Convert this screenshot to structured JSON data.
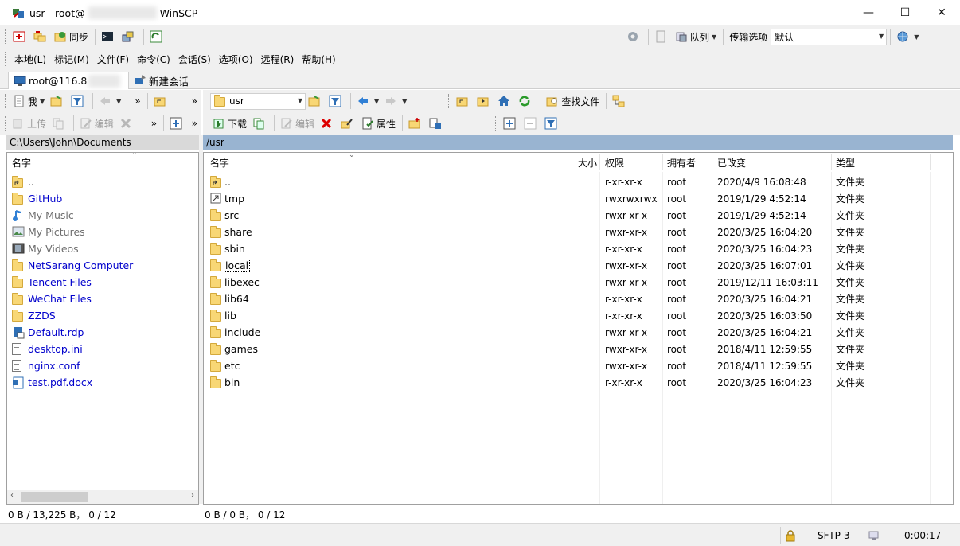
{
  "window": {
    "title_prefix": "usr - root@",
    "title_suffix": "WinSCP",
    "minimize": "—",
    "maximize": "☐",
    "close": "✕"
  },
  "toolbar1": {
    "sync_label": "同步",
    "queue_label": "队列",
    "transfer_options_label": "传输选项",
    "transfer_preset": "默认"
  },
  "menu": [
    "本地(L)",
    "标记(M)",
    "文件(F)",
    "命令(C)",
    "会话(S)",
    "选项(O)",
    "远程(R)",
    "帮助(H)"
  ],
  "tabs": {
    "session_label": "root@116.8",
    "new_session_label": "新建会话"
  },
  "left_toolbar": {
    "drive_label": "我",
    "upload_label": "上传",
    "edit_label": "编辑"
  },
  "right_toolbar": {
    "path_combo": "usr",
    "find_files_label": "查找文件",
    "download_label": "下载",
    "edit_label": "编辑",
    "properties_label": "属性"
  },
  "left_panel": {
    "path": "C:\\Users\\John\\Documents",
    "col_name": "名字",
    "items": [
      {
        "name": "..",
        "icon": "parent-folder-icon",
        "color": "#000000"
      },
      {
        "name": "GitHub",
        "icon": "folder-icon",
        "color": "#0000cc"
      },
      {
        "name": "My Music",
        "icon": "music-icon",
        "color": "#6d6d6d"
      },
      {
        "name": "My Pictures",
        "icon": "pictures-icon",
        "color": "#6d6d6d"
      },
      {
        "name": "My Videos",
        "icon": "videos-icon",
        "color": "#6d6d6d"
      },
      {
        "name": "NetSarang Computer",
        "icon": "folder-icon",
        "color": "#0000cc"
      },
      {
        "name": "Tencent Files",
        "icon": "folder-icon",
        "color": "#0000cc"
      },
      {
        "name": "WeChat Files",
        "icon": "folder-icon",
        "color": "#0000cc"
      },
      {
        "name": "ZZDS",
        "icon": "folder-icon",
        "color": "#0000cc"
      },
      {
        "name": "Default.rdp",
        "icon": "rdp-file-icon",
        "color": "#0000cc"
      },
      {
        "name": "desktop.ini",
        "icon": "ini-file-icon",
        "color": "#0000cc"
      },
      {
        "name": "nginx.conf",
        "icon": "conf-file-icon",
        "color": "#0000cc"
      },
      {
        "name": "test.pdf.docx",
        "icon": "docx-file-icon",
        "color": "#0000cc"
      }
    ],
    "status": "0 B / 13,225 B， 0 / 12"
  },
  "right_panel": {
    "path": "/usr",
    "columns": {
      "name": "名字",
      "size": "大小",
      "perm": "权限",
      "owner": "拥有者",
      "changed": "已改变",
      "type": "类型"
    },
    "items": [
      {
        "name": "..",
        "perm": "r-xr-xr-x",
        "owner": "root",
        "changed": "2020/4/9 16:08:48",
        "type": "文件夹",
        "icon": "parent-folder-icon"
      },
      {
        "name": "tmp",
        "perm": "rwxrwxrwx",
        "owner": "root",
        "changed": "2019/1/29 4:52:14",
        "type": "文件夹",
        "icon": "link-icon"
      },
      {
        "name": "src",
        "perm": "rwxr-xr-x",
        "owner": "root",
        "changed": "2019/1/29 4:52:14",
        "type": "文件夹",
        "icon": "folder-icon"
      },
      {
        "name": "share",
        "perm": "rwxr-xr-x",
        "owner": "root",
        "changed": "2020/3/25 16:04:20",
        "type": "文件夹",
        "icon": "folder-icon"
      },
      {
        "name": "sbin",
        "perm": "r-xr-xr-x",
        "owner": "root",
        "changed": "2020/3/25 16:04:23",
        "type": "文件夹",
        "icon": "folder-icon"
      },
      {
        "name": "local",
        "perm": "rwxr-xr-x",
        "owner": "root",
        "changed": "2020/3/25 16:07:01",
        "type": "文件夹",
        "icon": "folder-icon"
      },
      {
        "name": "libexec",
        "perm": "rwxr-xr-x",
        "owner": "root",
        "changed": "2019/12/11 16:03:11",
        "type": "文件夹",
        "icon": "folder-icon"
      },
      {
        "name": "lib64",
        "perm": "r-xr-xr-x",
        "owner": "root",
        "changed": "2020/3/25 16:04:21",
        "type": "文件夹",
        "icon": "folder-icon"
      },
      {
        "name": "lib",
        "perm": "r-xr-xr-x",
        "owner": "root",
        "changed": "2020/3/25 16:03:50",
        "type": "文件夹",
        "icon": "folder-icon"
      },
      {
        "name": "include",
        "perm": "rwxr-xr-x",
        "owner": "root",
        "changed": "2020/3/25 16:04:21",
        "type": "文件夹",
        "icon": "folder-icon"
      },
      {
        "name": "games",
        "perm": "rwxr-xr-x",
        "owner": "root",
        "changed": "2018/4/11 12:59:55",
        "type": "文件夹",
        "icon": "folder-icon"
      },
      {
        "name": "etc",
        "perm": "rwxr-xr-x",
        "owner": "root",
        "changed": "2018/4/11 12:59:55",
        "type": "文件夹",
        "icon": "folder-icon"
      },
      {
        "name": "bin",
        "perm": "r-xr-xr-x",
        "owner": "root",
        "changed": "2020/3/25 16:04:23",
        "type": "文件夹",
        "icon": "folder-icon"
      }
    ],
    "status": "0 B / 0 B， 0 / 12"
  },
  "bottom": {
    "protocol": "SFTP-3",
    "elapsed": "0:00:17"
  }
}
